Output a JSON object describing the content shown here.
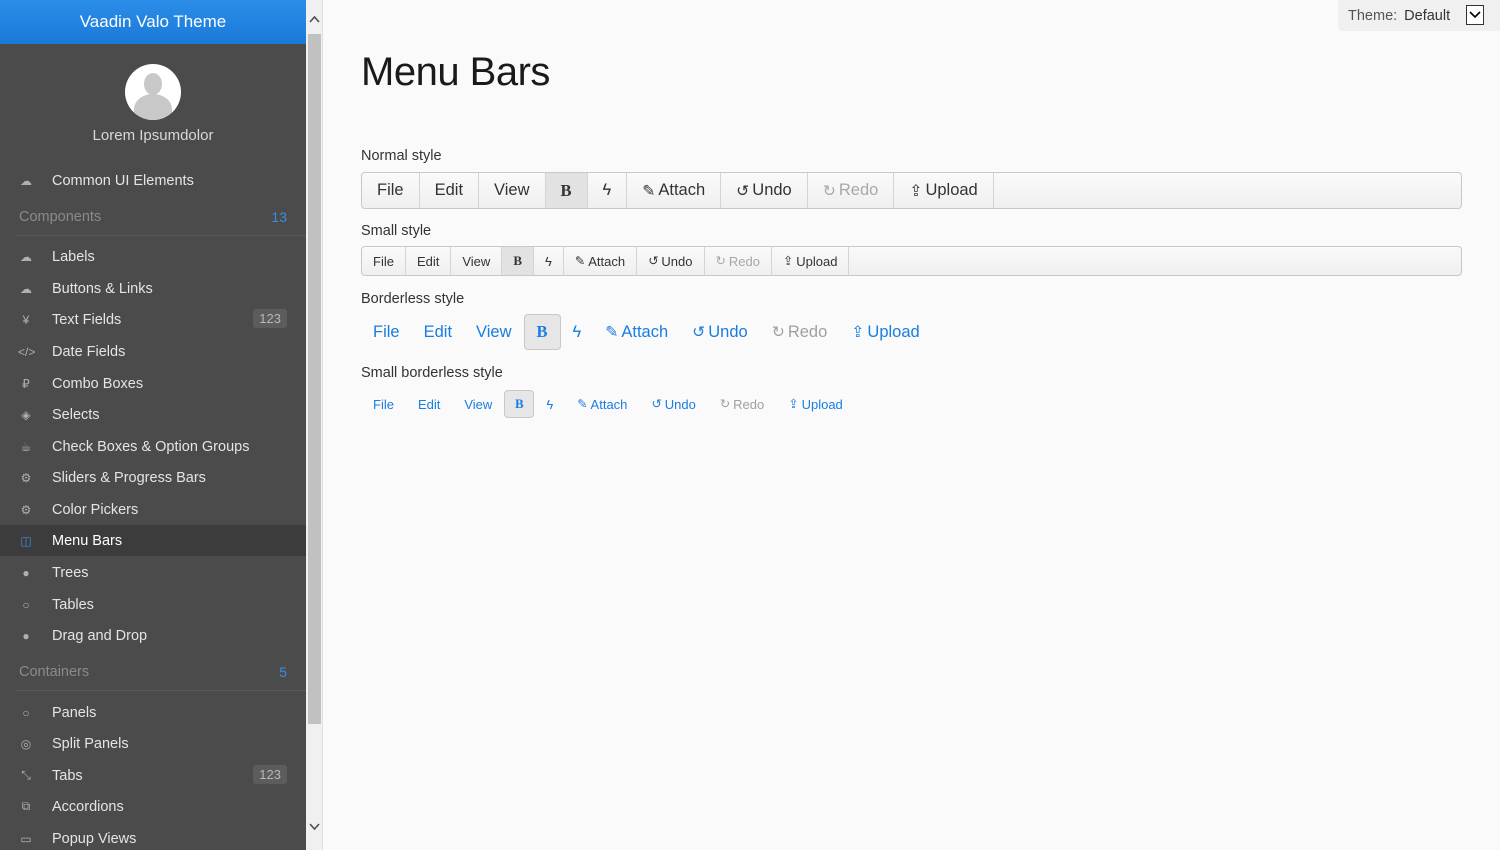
{
  "sidebar": {
    "header_prefix": "Vaadin",
    "header_name": "Valo Theme",
    "user_name": "Lorem Ipsumdolor",
    "items": [
      {
        "label": "Common UI Elements",
        "icon": "cloud-icon"
      },
      {
        "label": "Labels",
        "icon": "cloud-upload-icon"
      },
      {
        "label": "Buttons & Links",
        "icon": "cloud-download-icon"
      },
      {
        "label": "Text Fields",
        "icon": "yen-icon",
        "badge": "123"
      },
      {
        "label": "Date Fields",
        "icon": "code-icon"
      },
      {
        "label": "Combo Boxes",
        "icon": "ruble-icon"
      },
      {
        "label": "Selects",
        "icon": "codepen-icon"
      },
      {
        "label": "Check Boxes & Option Groups",
        "icon": "coffee-icon"
      },
      {
        "label": "Sliders & Progress Bars",
        "icon": "cog-icon"
      },
      {
        "label": "Color Pickers",
        "icon": "cogs-icon"
      },
      {
        "label": "Menu Bars",
        "icon": "columns-icon"
      },
      {
        "label": "Trees",
        "icon": "comment-icon"
      },
      {
        "label": "Tables",
        "icon": "comment-outline-icon"
      },
      {
        "label": "Drag and Drop",
        "icon": "comments-icon"
      },
      {
        "label": "Panels",
        "icon": "comments-outline-icon"
      },
      {
        "label": "Split Panels",
        "icon": "compass-icon"
      },
      {
        "label": "Tabs",
        "icon": "compress-icon",
        "badge": "123"
      },
      {
        "label": "Accordions",
        "icon": "copy-icon"
      },
      {
        "label": "Popup Views",
        "icon": "credit-card-icon"
      }
    ],
    "sections": [
      {
        "label": "Components",
        "count": "13"
      },
      {
        "label": "Containers",
        "count": "5"
      }
    ],
    "selected": "Menu Bars"
  },
  "theme": {
    "label": "Theme:",
    "value": "Default"
  },
  "page_title": "Menu Bars",
  "rows": {
    "normal_label": "Normal style",
    "small_label": "Small style",
    "borderless_label": "Borderless style",
    "small_borderless_label": "Small borderless style"
  },
  "menu": {
    "file": "File",
    "edit": "Edit",
    "view": "View",
    "bold": "B",
    "attach": "Attach",
    "undo": "Undo",
    "redo": "Redo",
    "upload": "Upload"
  },
  "colors": {
    "accent": "#197de1",
    "sidebar_bg": "#4b4b4b",
    "header_bg": "#1b79d8"
  }
}
